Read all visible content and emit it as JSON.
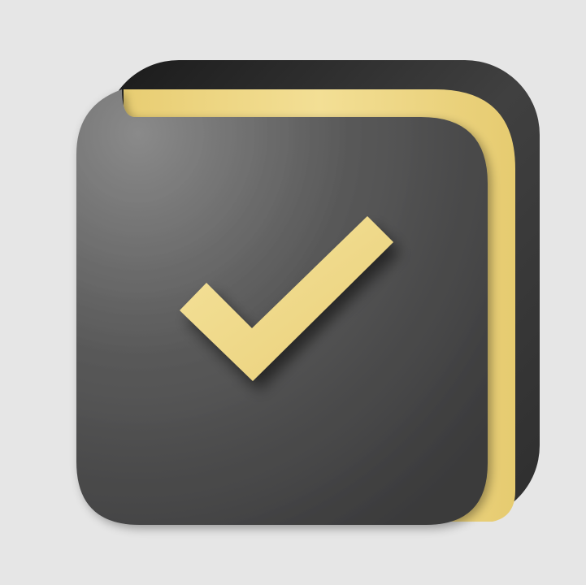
{
  "background_color": "#e6e6e6",
  "icon": {
    "name": "checklist-notebook-app-icon",
    "colors": {
      "cover_dark": "#3a3a3a",
      "cover_light": "#7a7a7a",
      "page_edge": "#f0d98a",
      "checkmark": "#f2dc8e"
    }
  }
}
